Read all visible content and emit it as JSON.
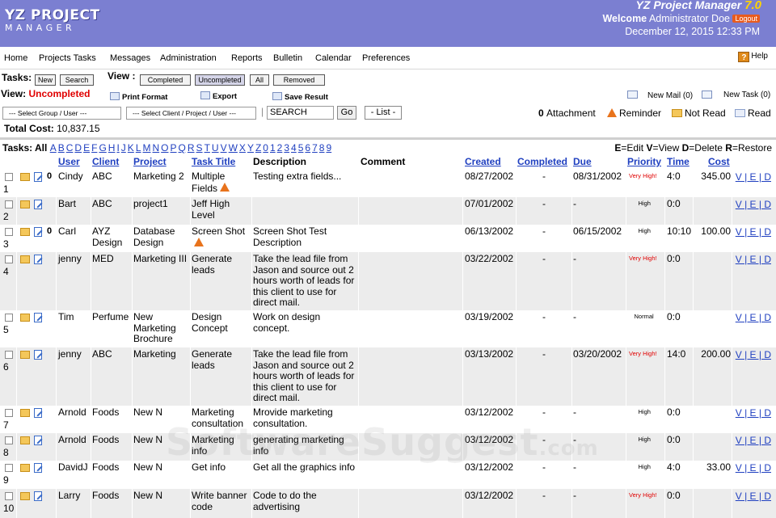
{
  "header": {
    "logo_line1": "YZ PROJECT",
    "logo_line2": "MANAGER",
    "app_title": "YZ Project Manager",
    "app_version": "7.0",
    "welcome_prefix": "Welcome",
    "welcome_user": "Administrator Doe",
    "logout_label": "Logout",
    "datetime": "December 12, 2015 12:33 PM"
  },
  "menu": {
    "items": [
      "Home",
      "Projects Tasks",
      "Messages",
      "Administration",
      "Reports",
      "Bulletin",
      "Calendar",
      "Preferences"
    ],
    "help": "Help"
  },
  "toolbar": {
    "tasks_label": "Tasks:",
    "new_label": "New",
    "search_label": "Search",
    "view_label": "View :",
    "view_buttons": [
      "Completed",
      "Uncompleted",
      "All",
      "Removed"
    ],
    "view_prefix": "View:",
    "view_current": "Uncompleted",
    "print_format": "Print Format",
    "export": "Export",
    "save_result": "Save Result",
    "new_mail": "New Mail (0)",
    "new_task": "New Task (0)",
    "select_group": "--- Select Group / User ---",
    "select_client": "--- Select Client / Project / User ---",
    "search_value": "SEARCH",
    "go_label": "Go",
    "list_label": "- List -",
    "legend_attachment": "Attachment",
    "legend_reminder": "Reminder",
    "legend_not_read": "Not Read",
    "legend_read": "Read",
    "total_cost_label": "Total Cost:",
    "total_cost_value": "10,837.15"
  },
  "tasks_bar": {
    "prefix": "Tasks: All",
    "letters": [
      "A",
      "B",
      "C",
      "D",
      "E",
      "F",
      "G",
      "H",
      "I",
      "J",
      "K",
      "L",
      "M",
      "N",
      "O",
      "P",
      "Q",
      "R",
      "S",
      "T",
      "U",
      "V",
      "W",
      "X",
      "Y",
      "Z",
      "0",
      "1",
      "2",
      "3",
      "4",
      "5",
      "6",
      "7",
      "8",
      "9"
    ],
    "keys": [
      "E",
      "=Edit ",
      "V",
      "=View ",
      "D",
      "=Delete ",
      "R",
      "=Restore"
    ]
  },
  "table": {
    "headers": {
      "user": "User",
      "client": "Client",
      "project": "Project",
      "task_title": "Task Title",
      "description": "Description",
      "comment": "Comment",
      "created": "Created",
      "completed": "Completed",
      "due": "Due",
      "priority": "Priority",
      "time": "Time",
      "cost": "Cost"
    },
    "rows": [
      {
        "num": "1",
        "attach": true,
        "user": "Cindy",
        "client": "ABC",
        "project": "Marketing 2",
        "title": "Multiple Fields",
        "warn": true,
        "description": "Testing extra fields...",
        "comment": "",
        "created": "08/27/2002",
        "completed": "-",
        "due": "08/31/2002",
        "priority": "Very High!",
        "time": "4:0",
        "cost": "345.00",
        "actions": "V | E | D"
      },
      {
        "num": "2",
        "attach": false,
        "user": "Bart",
        "client": "ABC",
        "project": "project1",
        "title": "Jeff High Level",
        "warn": false,
        "description": "",
        "comment": "",
        "created": "07/01/2002",
        "completed": "-",
        "due": "-",
        "priority": "High",
        "time": "0:0",
        "cost": "",
        "actions": "V | E | D"
      },
      {
        "num": "3",
        "attach": true,
        "user": "Carl",
        "client": "AYZ Design",
        "project": "Database Design",
        "title": "Screen Shot",
        "warn": true,
        "description": "Screen Shot Test Description",
        "comment": "",
        "created": "06/13/2002",
        "completed": "-",
        "due": "06/15/2002",
        "priority": "High",
        "time": "10:10",
        "cost": "100.00",
        "actions": "V | E | D"
      },
      {
        "num": "4",
        "attach": false,
        "user": "jenny",
        "client": "MED",
        "project": "Marketing III",
        "title": "Generate leads",
        "warn": false,
        "description": "Take the lead file from Jason and source out 2 hours worth of leads for this client to use for direct mail.",
        "comment": "",
        "created": "03/22/2002",
        "completed": "-",
        "due": "-",
        "priority": "Very High!",
        "time": "0:0",
        "cost": "",
        "actions": "V | E | D"
      },
      {
        "num": "5",
        "attach": false,
        "user": "Tim",
        "client": "Perfume",
        "project": "New Marketing Brochure",
        "title": "Design Concept",
        "warn": false,
        "description": "Work on design concept.",
        "comment": "",
        "created": "03/19/2002",
        "completed": "-",
        "due": "-",
        "priority": "Normal",
        "time": "0:0",
        "cost": "",
        "actions": "V | E | D"
      },
      {
        "num": "6",
        "attach": false,
        "user": "jenny",
        "client": "ABC",
        "project": "Marketing",
        "title": "Generate leads",
        "warn": false,
        "description": "Take the lead file from Jason and source out 2 hours worth of leads for this client to use for direct mail.",
        "comment": "",
        "created": "03/13/2002",
        "completed": "-",
        "due": "03/20/2002",
        "priority": "Very High!",
        "time": "14:0",
        "cost": "200.00",
        "actions": "V | E | D"
      },
      {
        "num": "7",
        "attach": false,
        "user": "Arnold",
        "client": "Foods",
        "project": "New N",
        "title": "Marketing consultation",
        "warn": false,
        "description": "Mrovide marketing consultation.",
        "comment": "",
        "created": "03/12/2002",
        "completed": "-",
        "due": "-",
        "priority": "High",
        "time": "0:0",
        "cost": "",
        "actions": "V | E | D"
      },
      {
        "num": "8",
        "attach": false,
        "user": "Arnold",
        "client": "Foods",
        "project": "New N",
        "title": "Marketing info",
        "warn": false,
        "description": "generating marketing info",
        "comment": "",
        "created": "03/12/2002",
        "completed": "-",
        "due": "-",
        "priority": "High",
        "time": "0:0",
        "cost": "",
        "actions": "V | E | D"
      },
      {
        "num": "9",
        "attach": false,
        "user": "DavidJ",
        "client": "Foods",
        "project": "New N",
        "title": "Get info",
        "warn": false,
        "description": "Get all the graphics info",
        "comment": "",
        "created": "03/12/2002",
        "completed": "-",
        "due": "-",
        "priority": "High",
        "time": "4:0",
        "cost": "33.00",
        "actions": "V | E | D"
      },
      {
        "num": "10",
        "attach": false,
        "user": "Larry",
        "client": "Foods",
        "project": "New N",
        "title": "Write banner code",
        "warn": false,
        "description": "Code to do the advertising",
        "comment": "",
        "created": "03/12/2002",
        "completed": "-",
        "due": "-",
        "priority": "Very High!",
        "time": "0:0",
        "cost": "",
        "actions": "V | E | D"
      }
    ]
  },
  "watermark": "SoftwareSuggest",
  "watermark_suffix": ".com"
}
